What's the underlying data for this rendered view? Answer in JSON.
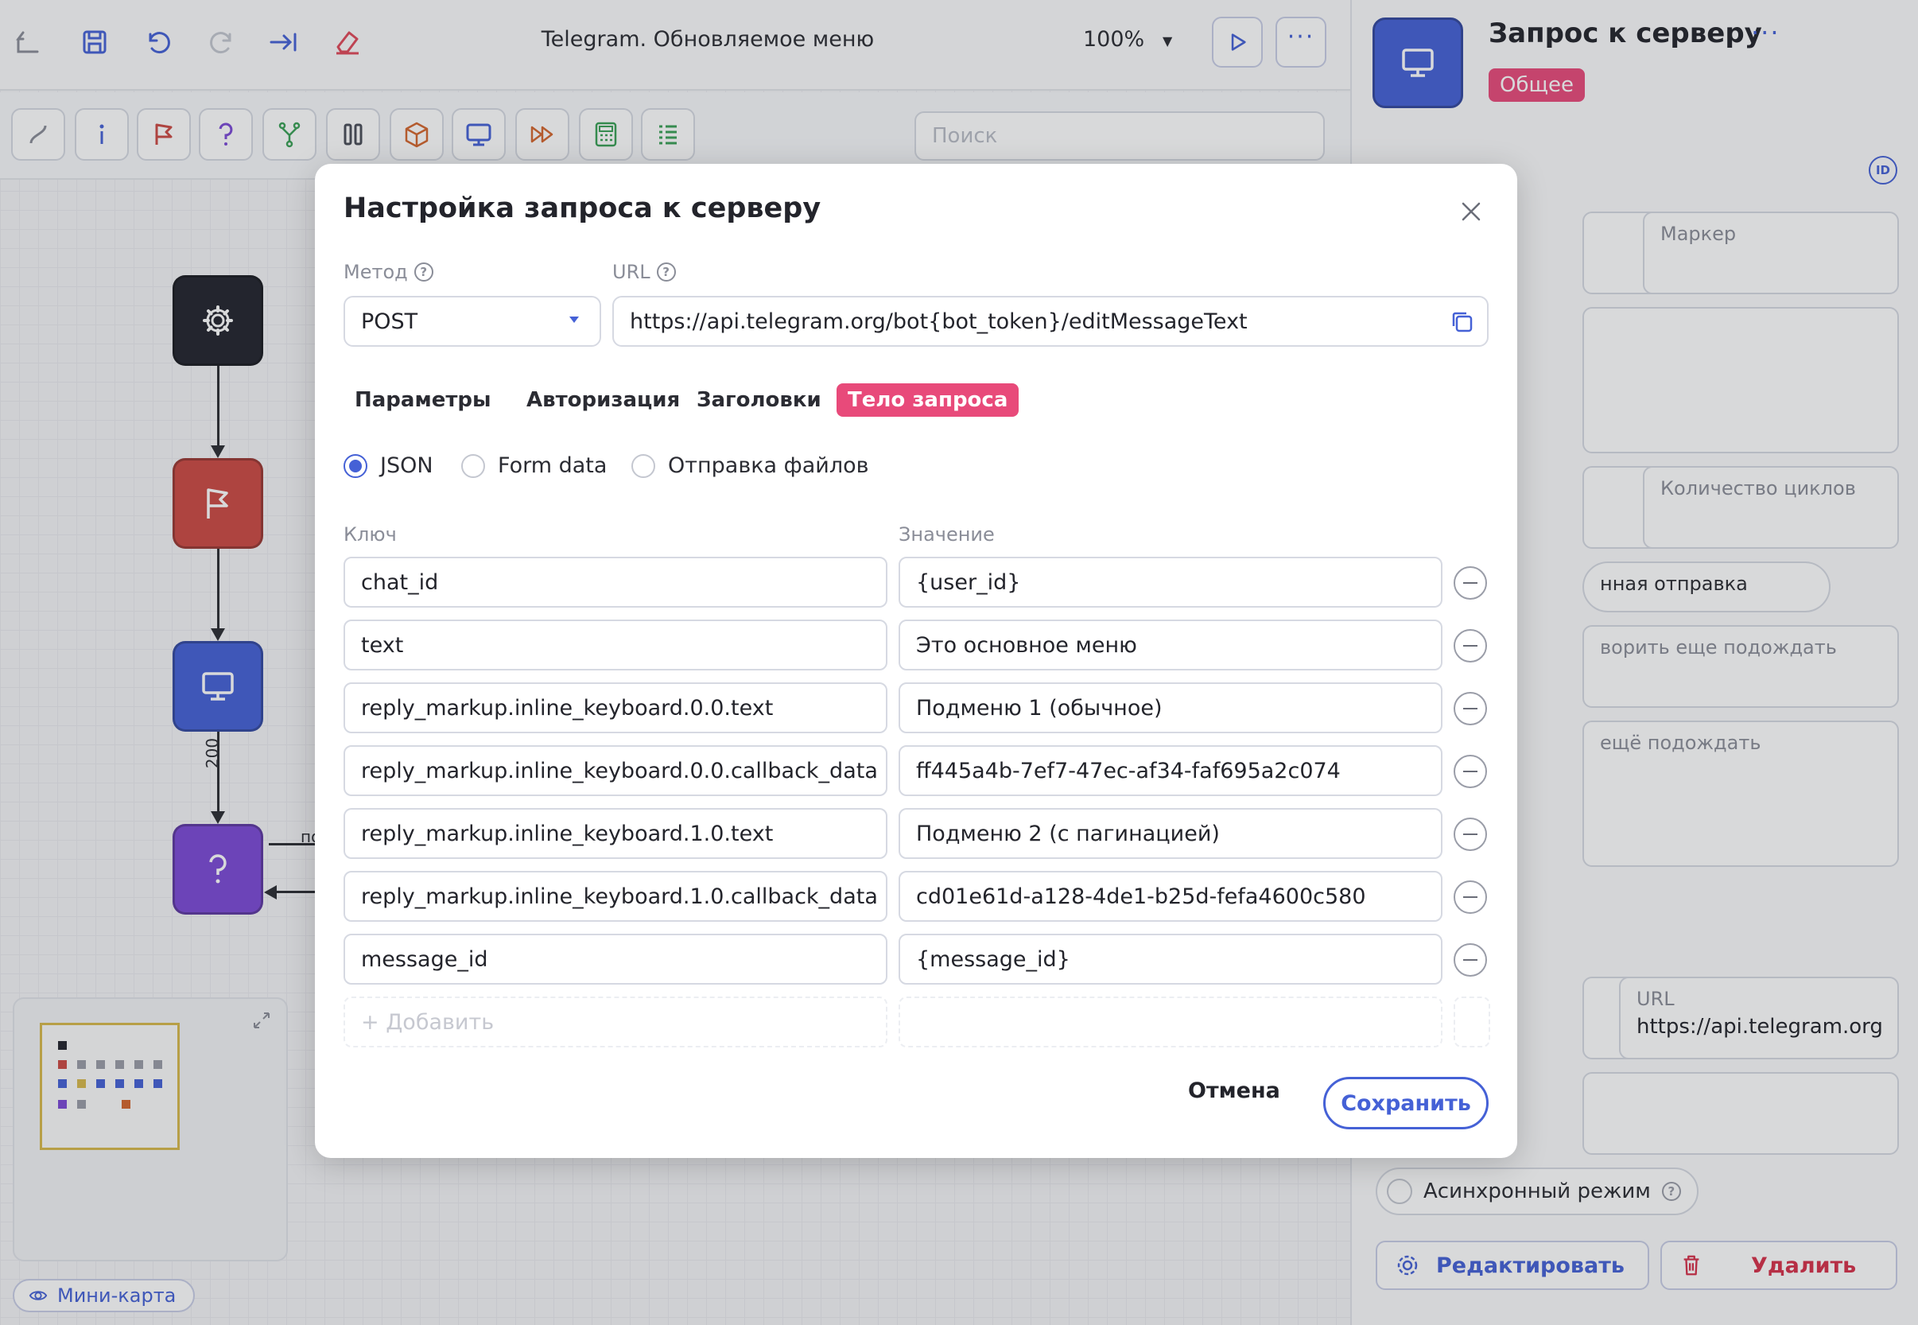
{
  "editor": {
    "title": "Telegram. Обновляемое меню",
    "zoom": "100%",
    "search_placeholder": "Поиск",
    "edge_label": "200",
    "edge_label_2": "по",
    "minimap_button": "Мини-карта"
  },
  "right_panel": {
    "title": "Запрос к серверу",
    "tag": "Общее",
    "id_badge": "ID",
    "fields": {
      "marker": "Маркер",
      "cycles": "Количество циклов",
      "delayed_send": "нная отправка",
      "wait_more": "ворить еще подождать",
      "wait_more_2": "ещё подождать",
      "url_label": "URL",
      "url_value": "https://api.telegram.org"
    },
    "async_label": "Асинхронный режим",
    "edit_label": "Редактировать",
    "delete_label": "Удалить"
  },
  "modal": {
    "title": "Настройка запроса к серверу",
    "method_label": "Метод",
    "method_value": "POST",
    "url_label": "URL",
    "url_value": "https://api.telegram.org/bot{bot_token}/editMessageText",
    "tabs": [
      {
        "label": "Параметры"
      },
      {
        "label": "Авторизация"
      },
      {
        "label": "Заголовки"
      },
      {
        "label": "Тело запроса",
        "active": true
      }
    ],
    "body_types": [
      {
        "label": "JSON",
        "selected": true
      },
      {
        "label": "Form data"
      },
      {
        "label": "Отправка файлов"
      }
    ],
    "key_header": "Ключ",
    "value_header": "Значение",
    "rows": [
      {
        "key": "chat_id",
        "value": "{user_id}"
      },
      {
        "key": "text",
        "value": "Это основное меню"
      },
      {
        "key": "reply_markup.inline_keyboard.0.0.text",
        "value": "Подменю 1 (обычное)"
      },
      {
        "key": "reply_markup.inline_keyboard.0.0.callback_data",
        "value": "ff445a4b-7ef7-47ec-af34-faf695a2c074"
      },
      {
        "key": "reply_markup.inline_keyboard.1.0.text",
        "value": "Подменю 2 (с пагинацией)"
      },
      {
        "key": "reply_markup.inline_keyboard.1.0.callback_data",
        "value": "cd01e61d-a128-4de1-b25d-fefa4600c580"
      },
      {
        "key": "message_id",
        "value": "{message_id}"
      }
    ],
    "add_placeholder": "+ Добавить",
    "cancel_label": "Отмена",
    "save_label": "Сохранить"
  },
  "colors": {
    "accent": "#4561d6",
    "tag_pink": "#e84a7a",
    "settings_node": "#23242e",
    "flag_node": "#cc4a44",
    "screen_node": "#4561d6",
    "question_node": "#7c4ad6"
  }
}
